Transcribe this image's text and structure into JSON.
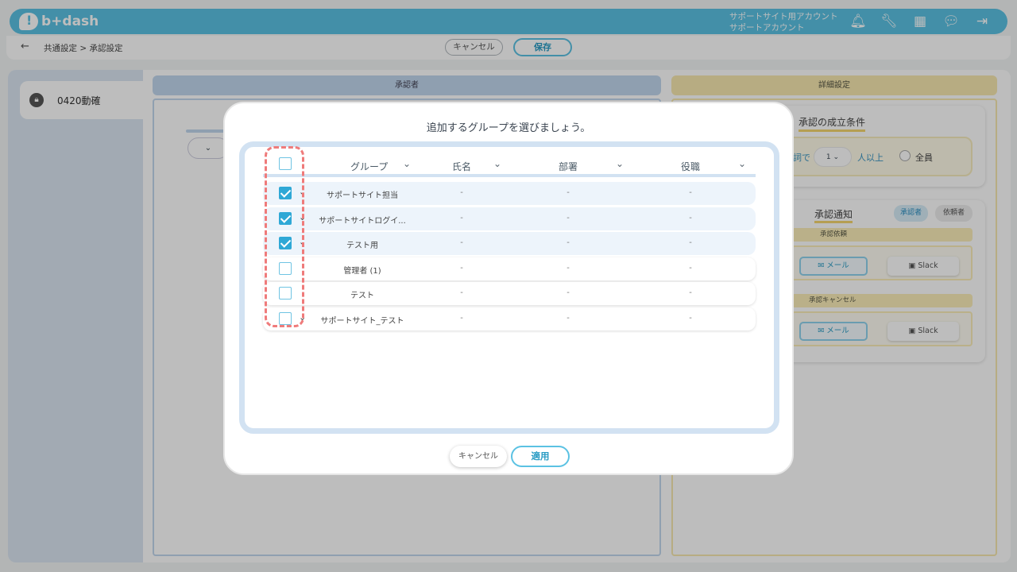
{
  "header": {
    "brand": "b+dash",
    "account_line1": "サポートサイト用アカウント",
    "account_line2": "サポートアカウント",
    "icons": [
      "bell-icon",
      "wrench-icon",
      "grid-icon",
      "chat-icon",
      "logout-icon"
    ]
  },
  "subheader": {
    "breadcrumb": "共通設定 > 承認設定",
    "cancel_label": "キャンセル",
    "save_label": "保存"
  },
  "sidebar": {
    "items": [
      {
        "label": "0420動確",
        "icon": "lock-icon"
      }
    ]
  },
  "approver_panel": {
    "title": "承認者"
  },
  "detail_panel": {
    "title": "詳細設定",
    "condition": {
      "title": "承認の成立条件",
      "with_fragment": "詞で",
      "count_value": "1",
      "more_label": "人以上",
      "all_label": "全員"
    },
    "notification": {
      "title": "承認通知",
      "approver_label": "承認者",
      "requester_label": "依頼者",
      "request_label": "承認依頼",
      "cancel_label": "承認キャンセル",
      "mail_label": "メール",
      "slack_label": "Slack"
    }
  },
  "modal": {
    "title": "追加するグループを選びましょう。",
    "columns": [
      "グループ",
      "氏名",
      "部署",
      "役職"
    ],
    "rows": [
      {
        "group": "サポートサイト担当",
        "name": "-",
        "dept": "-",
        "role": "-",
        "checked": true
      },
      {
        "group": "サポートサイトログイ...",
        "name": "-",
        "dept": "-",
        "role": "-",
        "checked": true
      },
      {
        "group": "テスト用",
        "name": "-",
        "dept": "-",
        "role": "-",
        "checked": true
      },
      {
        "group": "管理者 (1)",
        "name": "-",
        "dept": "-",
        "role": "-",
        "checked": false
      },
      {
        "group": "テスト",
        "name": "-",
        "dept": "-",
        "role": "-",
        "checked": false
      },
      {
        "group": "サポートサイト_テスト",
        "name": "-",
        "dept": "-",
        "role": "-",
        "checked": false
      }
    ],
    "cancel_label": "キャンセル",
    "apply_label": "適用"
  },
  "colors": {
    "brand": "#5bc2e3",
    "check": "#2fa8d6",
    "highlight": "#ef7b7b"
  }
}
